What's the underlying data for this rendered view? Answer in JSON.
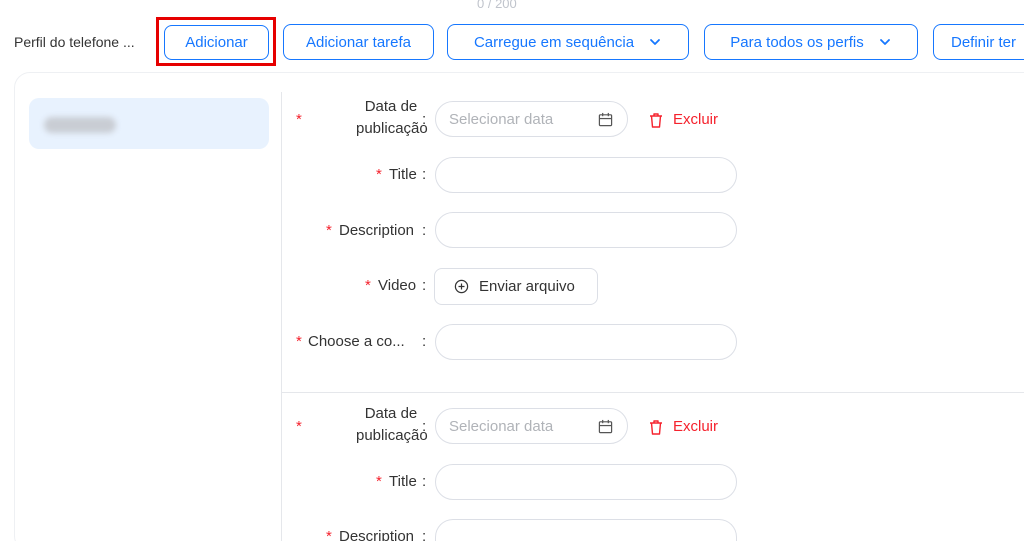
{
  "counter": "0 / 200",
  "toolbar": {
    "profile_label": "Perfil do telefone ...",
    "add_label": "Adicionar",
    "add_task_label": "Adicionar tarefa",
    "load_sequence_label": "Carregue em sequência",
    "all_profiles_label": "Para todos os perfis",
    "define_label": "Definir ter"
  },
  "tasks": [
    {
      "date_label_line1": "Data de",
      "date_label_line2": "publicação",
      "date_placeholder": "Selecionar data",
      "delete_label": "Excluir",
      "title_label": "Title",
      "description_label": "Description",
      "video_label": "Video",
      "upload_label": "Enviar arquivo",
      "choose_label": "Choose a co..."
    },
    {
      "date_label_line1": "Data de",
      "date_label_line2": "publicação",
      "date_placeholder": "Selecionar data",
      "delete_label": "Excluir",
      "title_label": "Title",
      "description_label": "Description"
    }
  ],
  "colors": {
    "accent": "#1677ff",
    "danger": "#f5222d",
    "highlight": "#e60000",
    "side_selected": "#e8f2fe"
  }
}
